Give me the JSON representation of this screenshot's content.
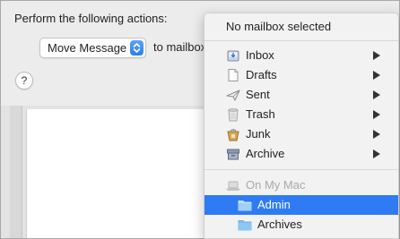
{
  "sheet": {
    "actions_label": "Perform the following actions:",
    "action_popup": "Move Message",
    "to_label": "to mailbox",
    "help_label": "?"
  },
  "menu": {
    "header": "No mailbox selected",
    "mailboxes": [
      {
        "label": "Inbox",
        "icon": "inbox-icon"
      },
      {
        "label": "Drafts",
        "icon": "drafts-icon"
      },
      {
        "label": "Sent",
        "icon": "sent-icon"
      },
      {
        "label": "Trash",
        "icon": "trash-icon"
      },
      {
        "label": "Junk",
        "icon": "junk-icon"
      },
      {
        "label": "Archive",
        "icon": "archive-icon"
      }
    ],
    "section_label": "On My Mac",
    "folders": [
      {
        "label": "Admin",
        "icon": "folder-icon",
        "selected": true
      },
      {
        "label": "Archives",
        "icon": "folder-icon",
        "selected": false
      }
    ]
  },
  "colors": {
    "selection": "#2f7bf3",
    "accent": "#2a7ef0",
    "folder_blue": "#8cc8f4"
  }
}
